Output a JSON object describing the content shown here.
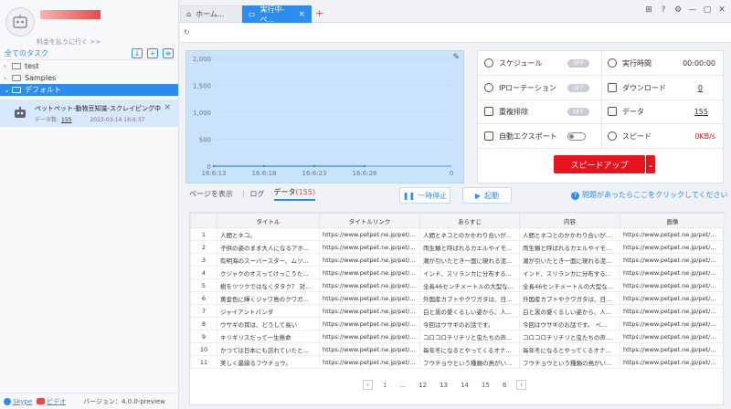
{
  "sidebar": {
    "upgrade_label": "料金を払うに行く >>",
    "tasks_header": "全てのタスク",
    "folders": [
      {
        "label": "test",
        "active": false
      },
      {
        "label": "Samples",
        "active": false
      },
      {
        "label": "デフォルト",
        "active": true
      }
    ],
    "task": {
      "name": "ペットペット-動物豆知識-スクレイピング中",
      "count_label": "データ数:",
      "count": "155",
      "datetime": "2023-03-14 16:6:37"
    },
    "footer": {
      "skype": "Skype",
      "video": "ビデオ",
      "version": "バージョン：4.0.0-preview"
    }
  },
  "tabs": [
    {
      "label": "ホーム...",
      "icon": "home-icon",
      "active": false
    },
    {
      "label": "実行中-ペ...",
      "icon": "window-icon",
      "active": true
    }
  ],
  "chart_data": {
    "type": "area",
    "x": [
      "16:6:13",
      "16:6:18",
      "16:6:23",
      "16:6:28"
    ],
    "x_end_label": "0",
    "yticks": [
      "2,000",
      "1,500",
      "1,000",
      "500",
      "0"
    ],
    "ylim": [
      0,
      2000
    ],
    "series": [
      {
        "values": [
          0,
          0,
          0,
          0
        ]
      }
    ]
  },
  "stats": {
    "schedule": {
      "label": "スケジュール",
      "state": "OFF"
    },
    "run_time": {
      "label": "実行時間",
      "value": "00:00:00"
    },
    "ip_rotation": {
      "label": "IPローテーション",
      "state": "OFF"
    },
    "download": {
      "label": "ダウンロード",
      "value": "0"
    },
    "dedupe": {
      "label": "重複排除",
      "state": "OFF"
    },
    "data": {
      "label": "データ",
      "value": "155"
    },
    "auto_export": {
      "label": "自動エクスポート"
    },
    "speed": {
      "label": "スピード",
      "value": "0KB/s"
    },
    "speedup_label": "スピードアップ"
  },
  "subtabs": {
    "page_view": "ページを表示",
    "log": "ログ",
    "data": "データ",
    "data_count": "(155)"
  },
  "controls": {
    "pause": "一時停止",
    "start": "起動",
    "help": "問題があったらここをクリックしてください"
  },
  "table": {
    "headers": [
      "",
      "タイトル",
      "タイトルリンク",
      "あらすじ",
      "内容",
      "画像"
    ],
    "rows": [
      [
        "1",
        "人間とネコ。",
        "https://www.petpet.ne.jp/pet/mam...",
        "人間とネコとのかかわり合いが...",
        "人間とネコとのかかわり合いが...",
        "https://www.petpet.ne.jp/pet/mam..."
      ],
      [
        "2",
        "子供の姿のまま大人になるアホ...",
        "https://www.petpet.ne.jp/pet/mam...",
        "両生類と呼ばれるカエルやイモ...",
        "両生類と呼ばれるカエルやイモ...",
        "https://www.petpet.ne.jp/pet/mam..."
      ],
      [
        "3",
        "有明海のスーパースター、ムツ...",
        "https://www.petpet.ne.jp/pet/mam...",
        "潮が引いたとき一面に現れる泥...",
        "潮が引いたとき一面に現れる泥...",
        "https://www.petpet.ne.jp/pet/mam..."
      ],
      [
        "4",
        "クジャクのオスってけっこうた...",
        "https://www.petpet.ne.jp/pet/mam...",
        "インド、スリランカに分布する...",
        "インド、スリランカに分布する...",
        "https://www.petpet.ne.jp/pet/mam..."
      ],
      [
        "5",
        "樹をツツクではなくタタク？ 対...",
        "https://www.petpet.ne.jp/pet/mam...",
        "全長46センチメートルの大型な...",
        "全長46センチメートルの大型な...",
        "https://www.petpet.ne.jp/pet/mam..."
      ],
      [
        "6",
        "黄金色に輝くジャワ島のクワガ...",
        "https://www.petpet.ne.jp/pet/mam...",
        "外国産カブトやクワガタは、日...",
        "外国産カブトやクワガタは、日...",
        "https://www.petpet.ne.jp/pet/mam..."
      ],
      [
        "7",
        "ジャイアントパンダ",
        "https://www.petpet.ne.jp/pet/mam...",
        "白と黒の愛くるしい姿から、人...",
        "白と黒の愛くるしい姿から、人...",
        "https://www.petpet.ne.jp/pet/mam..."
      ],
      [
        "8",
        "ウサギの耳は、どうして長い",
        "https://www.petpet.ne.jp/pet/mam...",
        "今回はウサギのお話です。",
        "今回はウサギのお話です。 ペ...",
        "https://www.petpet.ne.jp/pet/mam..."
      ],
      [
        "9",
        "キリギリスだって一生懸命",
        "https://www.petpet.ne.jp/pet/mam...",
        "コロコロチリチリと虫たちの声...",
        "コロコロチリチリと虫たちの声...",
        "https://www.petpet.ne.jp/pet/mam..."
      ],
      [
        "10",
        "かつては日本にも訪れていたと...",
        "https://www.petpet.ne.jp/pet/mam...",
        "毎年冬になるとやってくるオナ...",
        "毎年冬になるとやってくるオナ...",
        "https://www.petpet.ne.jp/pet/mam..."
      ],
      [
        "11",
        "美しく最縁るフウチョウ。",
        "https://www.petpet.ne.jp/pet/mam...",
        "フウチョウという種類の鳥がい...",
        "フウチョウという種類の鳥がい...",
        "https://www.petpet.ne.jp/pet/mam..."
      ]
    ]
  },
  "pager": {
    "current": "1",
    "ellipsis": "...",
    "pages": [
      "12",
      "13",
      "14",
      "15"
    ],
    "last": "6"
  },
  "colors": {
    "accent": "#2d8cf0",
    "danger": "#e8141d",
    "chart_fill": "#c9e3fb"
  }
}
